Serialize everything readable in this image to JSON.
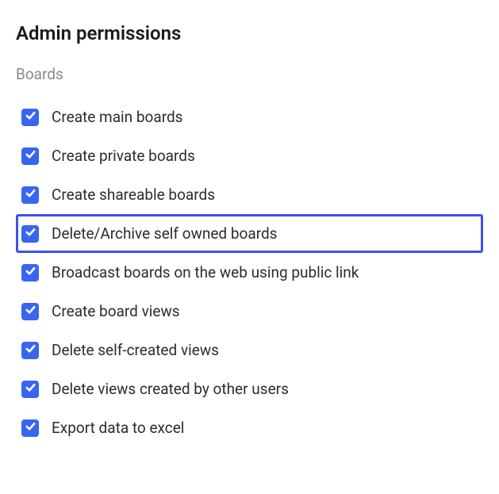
{
  "title": "Admin permissions",
  "section": {
    "heading": "Boards",
    "items": [
      {
        "label": "Create main boards",
        "checked": true,
        "highlighted": false
      },
      {
        "label": "Create private boards",
        "checked": true,
        "highlighted": false
      },
      {
        "label": "Create shareable boards",
        "checked": true,
        "highlighted": false
      },
      {
        "label": "Delete/Archive self owned boards",
        "checked": true,
        "highlighted": true
      },
      {
        "label": "Broadcast boards on the web using public link",
        "checked": true,
        "highlighted": false
      },
      {
        "label": "Create board views",
        "checked": true,
        "highlighted": false
      },
      {
        "label": "Delete self-created views",
        "checked": true,
        "highlighted": false
      },
      {
        "label": "Delete views created by other users",
        "checked": true,
        "highlighted": false
      },
      {
        "label": "Export data to excel",
        "checked": true,
        "highlighted": false
      }
    ]
  },
  "colors": {
    "checkbox": "#3866f0",
    "highlight_border": "#3e51e6"
  }
}
